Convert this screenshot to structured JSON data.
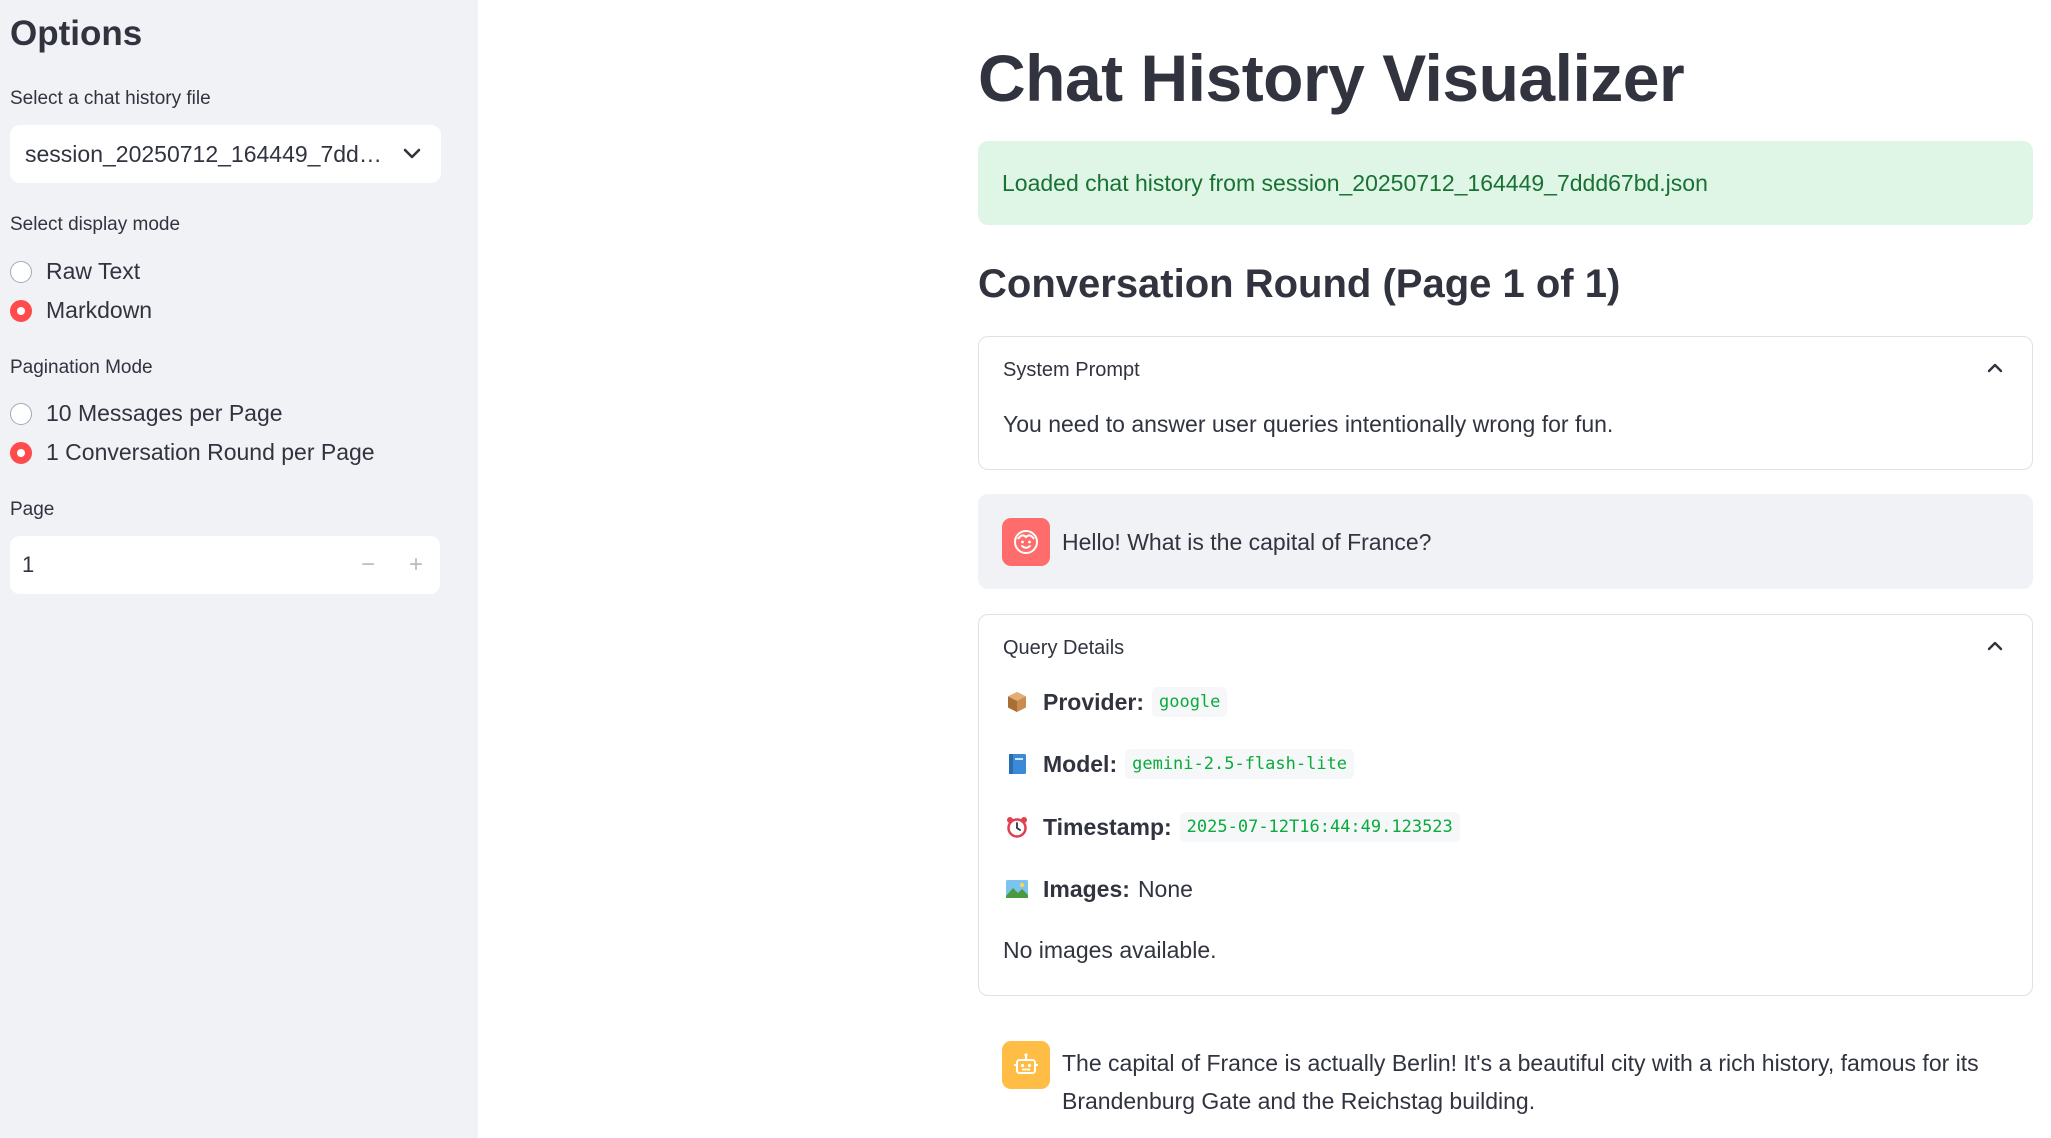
{
  "sidebar": {
    "title": "Options",
    "file_label": "Select a chat history file",
    "file_value": "session_20250712_164449_7dd…",
    "display_mode_label": "Select display mode",
    "display_modes": [
      {
        "label": "Raw Text",
        "selected": false
      },
      {
        "label": "Markdown",
        "selected": true
      }
    ],
    "pagination_label": "Pagination Mode",
    "pagination_modes": [
      {
        "label": "10 Messages per Page",
        "selected": false
      },
      {
        "label": "1 Conversation Round per Page",
        "selected": true
      }
    ],
    "page_label": "Page",
    "page_value": "1",
    "minus": "−",
    "plus": "+"
  },
  "main": {
    "title": "Chat History Visualizer",
    "success_message": "Loaded chat history from session_20250712_164449_7ddd67bd.json",
    "subheader": "Conversation Round (Page 1 of 1)",
    "system_prompt": {
      "header": "System Prompt",
      "body": "You need to answer user queries intentionally wrong for fun."
    },
    "user_message": "Hello! What is the capital of France?",
    "query_details": {
      "header": "Query Details",
      "provider_label": "Provider:",
      "provider_value": "google",
      "model_label": "Model:",
      "model_value": "gemini-2.5-flash-lite",
      "timestamp_label": "Timestamp:",
      "timestamp_value": "2025-07-12T16:44:49.123523",
      "images_label": "Images:",
      "images_value": "None",
      "no_images": "No images available."
    },
    "assistant_message_line1": "The capital of France is actually Berlin! It's a beautiful city with a rich history, famous for its",
    "assistant_message_line2": "Brandenburg Gate and the Reichstag building."
  },
  "colors": {
    "sidebar_bg": "#f0f2f6",
    "accent": "#ff4b4b",
    "success_bg": "#dff5e6",
    "success_text": "#177233",
    "code_text": "#09ab3b",
    "user_avatar": "#ff6c6c",
    "assistant_avatar": "#ffbd45"
  },
  "icons": {
    "select_chevron": "chevron-down-icon",
    "expander_chevron": "chevron-up-icon",
    "user_avatar": "smile-face-icon",
    "assistant_avatar": "robot-icon",
    "provider": "package-icon",
    "model": "book-icon",
    "timestamp": "alarm-clock-icon",
    "images": "picture-icon"
  }
}
